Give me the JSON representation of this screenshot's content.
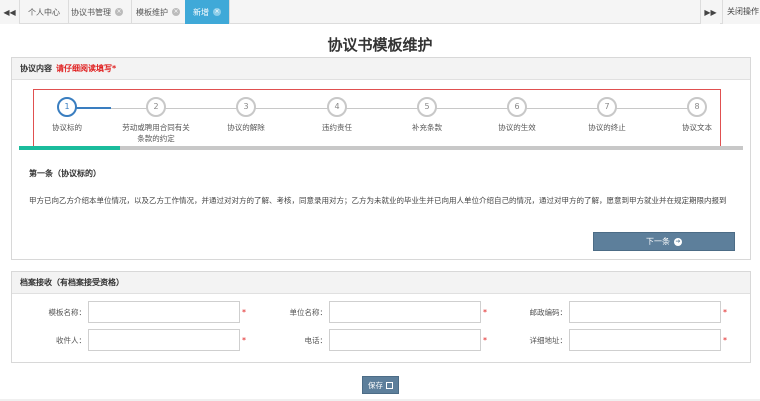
{
  "tabbar": {
    "prev_icon": "double-left-arrow",
    "next_icon": "double-right-arrow",
    "tabs": [
      {
        "label": "个人中心",
        "closable": false,
        "active": false
      },
      {
        "label": "协议书管理",
        "closable": true,
        "active": false
      },
      {
        "label": "模板维护",
        "closable": true,
        "active": false
      },
      {
        "label": "新增",
        "closable": true,
        "active": true
      }
    ],
    "close_ops_label": "关闭操作"
  },
  "page": {
    "title": "协议书模板维护"
  },
  "agreement_panel": {
    "header": "协议内容",
    "warning": "请仔细阅读填写*",
    "steps": [
      {
        "num": "1",
        "label": "协议标的",
        "current": true
      },
      {
        "num": "2",
        "label": "劳动或聘用合同有关条款的约定",
        "current": false
      },
      {
        "num": "3",
        "label": "协议的解除",
        "current": false
      },
      {
        "num": "4",
        "label": "违约责任",
        "current": false
      },
      {
        "num": "5",
        "label": "补充条款",
        "current": false
      },
      {
        "num": "6",
        "label": "协议的生效",
        "current": false
      },
      {
        "num": "7",
        "label": "协议的终止",
        "current": false
      },
      {
        "num": "8",
        "label": "协议文本",
        "current": false
      }
    ],
    "progress": 0.14,
    "progress_color": "#1abc9c",
    "article_title": "第一条（协议标的）",
    "article_body": "甲方已向乙方介绍本单位情况，以及乙方工作情况，并通过对对方的了解、考核，同意录用对方；乙方为未就业的毕业生并已向用人单位介绍自己的情况，通过对甲方的了解，愿意到甲方就业并在规定期限内报到",
    "next_button": "下一条"
  },
  "archive_panel": {
    "header": "档案接收（有档案接受资格）",
    "fields": [
      {
        "label": "模板名称：",
        "value": "",
        "required": true
      },
      {
        "label": "单位名称：",
        "value": "",
        "required": true
      },
      {
        "label": "邮政编码：",
        "value": "",
        "required": true
      },
      {
        "label": "收件人：",
        "value": "",
        "required": true
      },
      {
        "label": "电话：",
        "value": "",
        "required": true
      },
      {
        "label": "详细地址：",
        "value": "",
        "required": true
      }
    ],
    "required_mark": "*"
  },
  "footer": {
    "save_button": "保存"
  },
  "colors": {
    "accent_blue": "#3fa9d8",
    "button": "#5d7f9b",
    "warning_red": "#e02020"
  }
}
